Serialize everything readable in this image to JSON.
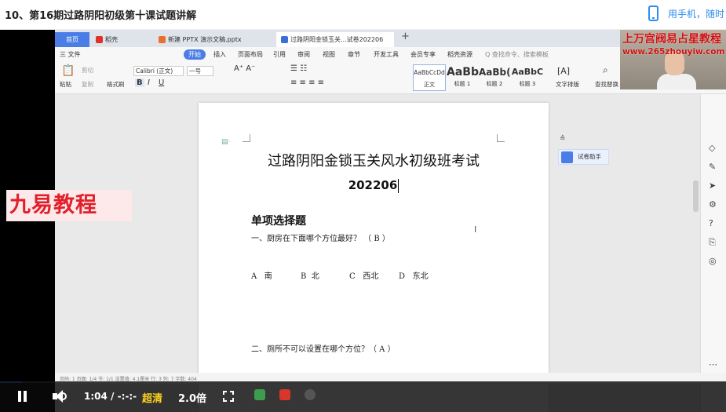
{
  "course": {
    "title": "10、第16期过路阴阳初级第十课试题讲解",
    "mobile_text": "用手机，随时"
  },
  "tabs": {
    "home": "首页",
    "t1": "稻壳",
    "t2": "新建 PPTX 演示文稿.pptx",
    "t3": "过路阴阳金锁玉关...试卷202206",
    "add": "+"
  },
  "menu": [
    "三 文件",
    "开始",
    "插入",
    "页面布局",
    "引用",
    "审阅",
    "视图",
    "章节",
    "开发工具",
    "会员专享",
    "稻壳资源",
    "Q 查找命令、搜索模板"
  ],
  "ribbon": {
    "paste": "粘贴",
    "cut": "剪切",
    "copy": "复制",
    "format_painter": "格式刷",
    "font_name": "Calibri (正文)",
    "font_size": "一号",
    "styles": [
      {
        "sample": "AaBbCcDd",
        "name": "正文"
      },
      {
        "sample": "AaBb",
        "name": "标题 1"
      },
      {
        "sample": "AaBb(",
        "name": "标题 2"
      },
      {
        "sample": "AaBbC",
        "name": "标题 3"
      }
    ],
    "text_layout": "文字排版",
    "find_replace": "查找替换"
  },
  "document": {
    "title": "过路阴阳金锁玉关风水初级班考试",
    "subtitle": "202206",
    "section": "单项选择题",
    "q1": "一、厨房在下面哪个方位最好？  （  B        ）",
    "options": [
      {
        "letter": "A",
        "text": "南"
      },
      {
        "letter": "B",
        "text": "北"
      },
      {
        "letter": "C",
        "text": "西北"
      },
      {
        "letter": "D",
        "text": "东北"
      }
    ],
    "q2": "二、厕所不可以设置在哪个方位？（    A        ）"
  },
  "assistant": {
    "label": "试卷助手"
  },
  "watermark": {
    "left_logo": "九易教程",
    "cam_line1": "上万宫阀易占星教程",
    "cam_line2": "www.265zhouyiw.com"
  },
  "status": {
    "text": "页码: 1    页面: 1/4    节: 1/1    设置值: 4.1厘米    行: 3    列: 7    字数: 404"
  },
  "player": {
    "time": "1:04  /  -:-:-",
    "quality": "超清",
    "speed": "2.0倍",
    "progress_fraction": 0.03
  }
}
